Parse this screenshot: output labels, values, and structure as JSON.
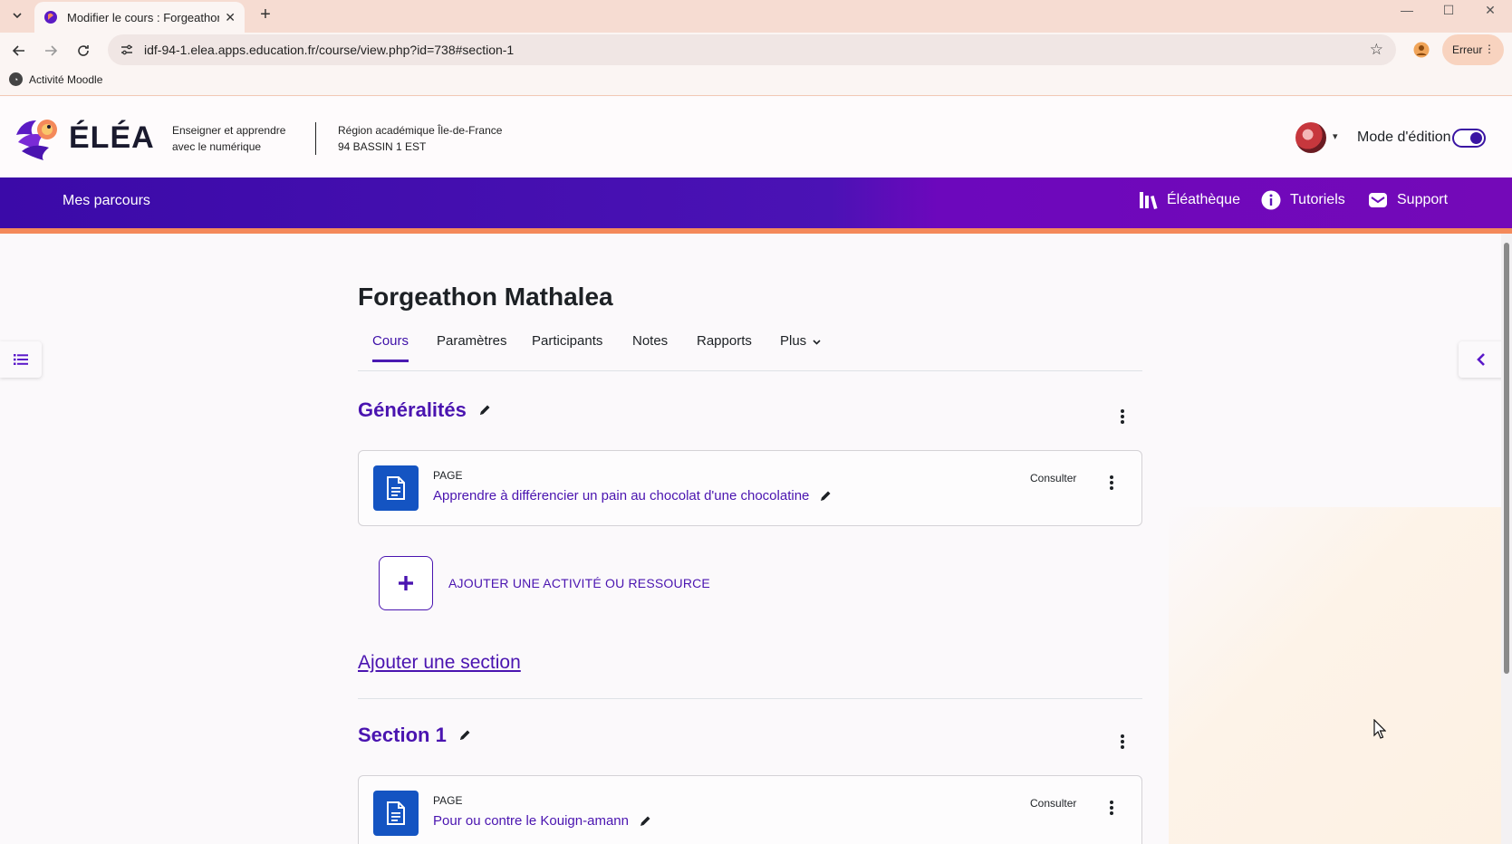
{
  "browser": {
    "tab_title": "Modifier le cours : Forgeathon Mathalea",
    "url": "idf-94-1.elea.apps.education.fr/course/view.php?id=738#section-1",
    "profile_status": "Erreur",
    "bookmark": "Activité Moodle"
  },
  "header": {
    "brand": "ÉLÉA",
    "tagline_1": "Enseigner et apprendre",
    "tagline_2": "avec le numérique",
    "region_1": "Région académique Île-de-France",
    "region_2": "94 BASSIN 1 EST",
    "edit_mode_label": "Mode d'édition",
    "edit_mode_on": true
  },
  "nav": {
    "mes_parcours": "Mes parcours",
    "links": [
      "Éléathèque",
      "Tutoriels",
      "Support"
    ]
  },
  "course": {
    "title": "Forgeathon Mathalea",
    "tabs": [
      "Cours",
      "Paramètres",
      "Participants",
      "Notes",
      "Rapports",
      "Plus"
    ],
    "active_tab": "Cours"
  },
  "sections": [
    {
      "title": "Généralités",
      "activity": {
        "type": "PAGE",
        "name": "Apprendre à différencier un pain au chocolat d'une chocolatine",
        "action": "Consulter"
      }
    },
    {
      "title": "Section 1",
      "activity": {
        "type": "PAGE",
        "name": "Pour ou contre le Kouign-amann",
        "action": "Consulter"
      }
    }
  ],
  "add_activity_label": "AJOUTER UNE ACTIVITÉ OU RESSOURCE",
  "add_section_label": "Ajouter une section",
  "colors": {
    "brand_purple": "#4a14b0",
    "nav_gradient_start": "#3b0aa8",
    "nav_gradient_end": "#7409b8",
    "accent_orange": "#f4895a",
    "activity_blue": "#1454c2"
  }
}
